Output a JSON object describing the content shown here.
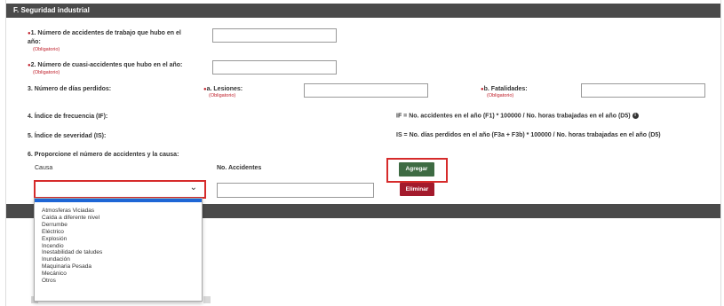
{
  "section_title": "F. Seguridad industrial",
  "q1": {
    "label_line1": "1. Número de accidentes de trabajo que hubo en el",
    "label_line2": "año:",
    "required": "(Obligatorio)",
    "value": ""
  },
  "q2": {
    "label": "2. Número de cuasi-accidentes que hubo en el año:",
    "required": "(Obligatorio)",
    "value": ""
  },
  "q3": {
    "label": "3. Número de días perdidos:",
    "a_label": "a. Lesiones:",
    "a_required": "(Obligatorio)",
    "b_label": "b. Fatalidades:",
    "b_required": "(Obligatorio)"
  },
  "q4": {
    "label": "4. Índice de frecuencia (IF):",
    "formula": "IF = No. accidentes en el año (F1) * 100000 / No. horas trabajadas en el año (D5)"
  },
  "q5": {
    "label": "5. Índice de severidad (IS):",
    "formula": "IS = No. días perdidos en el año (F3a + F3b) * 100000 / No. horas trabajadas en el año (D5)"
  },
  "q6": {
    "label": "6. Proporcione el número de accidentes y la causa:",
    "col_causa": "Causa",
    "col_accidentes": "No. Accidentes",
    "add_button": "Agregar",
    "remove_button": "Eliminar",
    "select_value": "",
    "options": [
      "Atmosferas Viciadas",
      "Caída a diferente nivel",
      "Derrumbe",
      "Eléctrico",
      "Explosión",
      "Incendio",
      "Inestabilidad de taludes",
      "Inundación",
      "Maquinaria Pesada",
      "Mecánico",
      "Otros"
    ]
  },
  "colors": {
    "header": "#4a4a4a",
    "required": "#c0202b",
    "add": "#3e6b43",
    "remove": "#a31a2c",
    "highlight": "#d62b2b"
  }
}
